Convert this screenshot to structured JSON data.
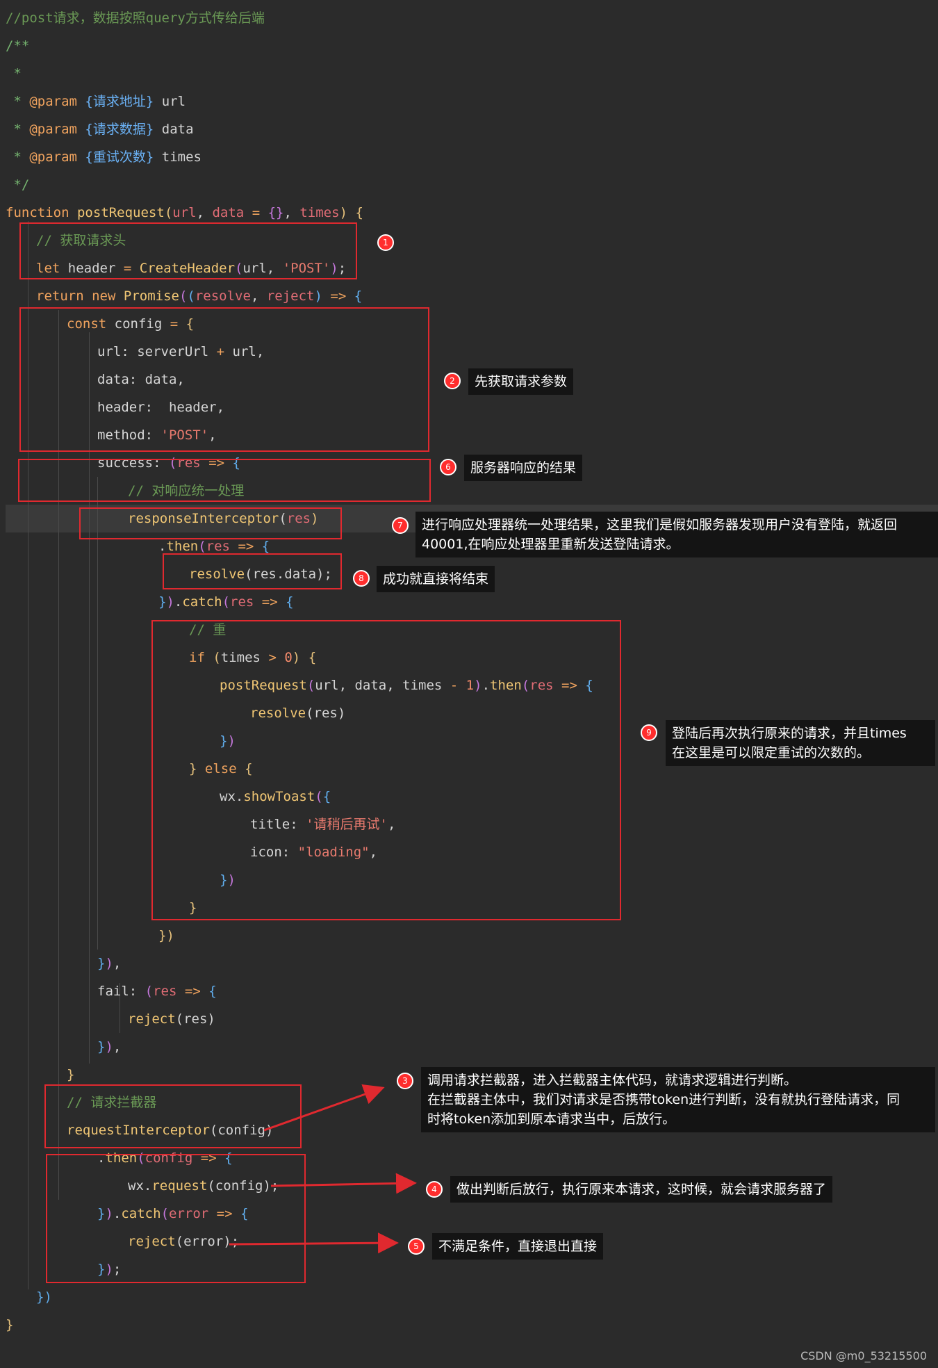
{
  "code_lines": [
    {
      "indent": 0,
      "tokens": [
        [
          "//post请求，数据按照query方式传给后端",
          "comment"
        ]
      ]
    },
    {
      "indent": 0,
      "tokens": [
        [
          "/**",
          "doc"
        ]
      ]
    },
    {
      "indent": 0,
      "tokens": [
        [
          " *",
          "doc"
        ]
      ]
    },
    {
      "indent": 0,
      "tokens": [
        [
          " * ",
          "doc"
        ],
        [
          "@param",
          "keyword"
        ],
        [
          " ",
          "doc"
        ],
        [
          "{请求地址}",
          "type"
        ],
        [
          " url",
          "plain"
        ]
      ]
    },
    {
      "indent": 0,
      "tokens": [
        [
          " * ",
          "doc"
        ],
        [
          "@param",
          "keyword"
        ],
        [
          " ",
          "doc"
        ],
        [
          "{请求数据}",
          "type"
        ],
        [
          " data",
          "plain"
        ]
      ]
    },
    {
      "indent": 0,
      "tokens": [
        [
          " * ",
          "doc"
        ],
        [
          "@param",
          "keyword"
        ],
        [
          " ",
          "doc"
        ],
        [
          "{重试次数}",
          "type"
        ],
        [
          " times",
          "plain"
        ]
      ]
    },
    {
      "indent": 0,
      "tokens": [
        [
          " */",
          "doc"
        ]
      ]
    },
    {
      "indent": 0,
      "tokens": [
        [
          "function",
          "keyword"
        ],
        [
          " ",
          "plain"
        ],
        [
          "postRequest",
          "func"
        ],
        [
          "(",
          "bracket1"
        ],
        [
          "url",
          "param"
        ],
        [
          ", ",
          "plain"
        ],
        [
          "data",
          "param"
        ],
        [
          " = ",
          "op"
        ],
        [
          "{}",
          "bracket2"
        ],
        [
          ", ",
          "plain"
        ],
        [
          "times",
          "param"
        ],
        [
          ")",
          "bracket1"
        ],
        [
          " ",
          "plain"
        ],
        [
          "{",
          "bracket1"
        ]
      ]
    },
    {
      "indent": 1,
      "tokens": [
        [
          "// 获取请求头",
          "comment"
        ]
      ]
    },
    {
      "indent": 1,
      "tokens": [
        [
          "let",
          "keyword"
        ],
        [
          " header ",
          "plain"
        ],
        [
          "=",
          "op"
        ],
        [
          " ",
          "plain"
        ],
        [
          "CreateHeader",
          "func"
        ],
        [
          "(",
          "bracket2"
        ],
        [
          "url, ",
          "plain"
        ],
        [
          "'POST'",
          "string"
        ],
        [
          ")",
          "bracket2"
        ],
        [
          ";",
          "plain"
        ]
      ]
    },
    {
      "indent": 1,
      "tokens": [
        [
          "return",
          "keyword"
        ],
        [
          " ",
          "plain"
        ],
        [
          "new",
          "keyword"
        ],
        [
          " ",
          "plain"
        ],
        [
          "Promise",
          "func"
        ],
        [
          "(",
          "bracket2"
        ],
        [
          "(",
          "bracket3"
        ],
        [
          "resolve",
          "param"
        ],
        [
          ", ",
          "plain"
        ],
        [
          "reject",
          "param"
        ],
        [
          ")",
          "bracket3"
        ],
        [
          " ",
          "plain"
        ],
        [
          "=>",
          "keyword"
        ],
        [
          " ",
          "plain"
        ],
        [
          "{",
          "bracket3"
        ]
      ]
    },
    {
      "indent": 2,
      "tokens": [
        [
          "const",
          "keyword"
        ],
        [
          " config ",
          "plain"
        ],
        [
          "=",
          "op"
        ],
        [
          " ",
          "plain"
        ],
        [
          "{",
          "bracket1"
        ]
      ]
    },
    {
      "indent": 3,
      "tokens": [
        [
          "url",
          "prop"
        ],
        [
          ": serverUrl ",
          "plain"
        ],
        [
          "+",
          "op"
        ],
        [
          " url,",
          "plain"
        ]
      ]
    },
    {
      "indent": 3,
      "tokens": [
        [
          "data",
          "prop"
        ],
        [
          ": data,",
          "plain"
        ]
      ]
    },
    {
      "indent": 3,
      "tokens": [
        [
          "header",
          "prop"
        ],
        [
          ":  header,",
          "plain"
        ]
      ]
    },
    {
      "indent": 3,
      "tokens": [
        [
          "method",
          "prop"
        ],
        [
          ": ",
          "plain"
        ],
        [
          "'POST'",
          "string"
        ],
        [
          ",",
          "plain"
        ]
      ]
    },
    {
      "indent": 3,
      "tokens": [
        [
          "success",
          "prop"
        ],
        [
          ": ",
          "plain"
        ],
        [
          "(",
          "bracket2"
        ],
        [
          "res",
          "param"
        ],
        [
          " ",
          "plain"
        ],
        [
          "=>",
          "keyword"
        ],
        [
          " ",
          "plain"
        ],
        [
          "{",
          "bracket3"
        ]
      ]
    },
    {
      "indent": 4,
      "tokens": [
        [
          "// 对响应统一处理",
          "comment"
        ]
      ]
    },
    {
      "indent": 4,
      "tokens": [
        [
          "responseInterceptor",
          "func"
        ],
        [
          "(",
          "plain"
        ],
        [
          "res",
          "param"
        ],
        [
          ")",
          "bracket1"
        ]
      ]
    },
    {
      "indent": 5,
      "tokens": [
        [
          ".",
          "plain"
        ],
        [
          "then",
          "func"
        ],
        [
          "(",
          "bracket2"
        ],
        [
          "res",
          "param"
        ],
        [
          " ",
          "plain"
        ],
        [
          "=>",
          "keyword"
        ],
        [
          " ",
          "plain"
        ],
        [
          "{",
          "bracket3"
        ]
      ]
    },
    {
      "indent": 6,
      "tokens": [
        [
          "resolve",
          "func"
        ],
        [
          "(res.data);",
          "plain"
        ]
      ]
    },
    {
      "indent": 5,
      "tokens": [
        [
          "}",
          "bracket3"
        ],
        [
          ")",
          "bracket2"
        ],
        [
          ".",
          "plain"
        ],
        [
          "catch",
          "func"
        ],
        [
          "(",
          "bracket2"
        ],
        [
          "res",
          "param"
        ],
        [
          " ",
          "plain"
        ],
        [
          "=>",
          "keyword"
        ],
        [
          " ",
          "plain"
        ],
        [
          "{",
          "bracket3"
        ]
      ]
    },
    {
      "indent": 6,
      "tokens": [
        [
          "// 重",
          "comment"
        ]
      ]
    },
    {
      "indent": 6,
      "tokens": [
        [
          "if",
          "keyword"
        ],
        [
          " ",
          "plain"
        ],
        [
          "(",
          "bracket1"
        ],
        [
          "times ",
          "plain"
        ],
        [
          ">",
          "op"
        ],
        [
          " ",
          "plain"
        ],
        [
          "0",
          "number"
        ],
        [
          ")",
          "bracket1"
        ],
        [
          " ",
          "plain"
        ],
        [
          "{",
          "bracket1"
        ]
      ]
    },
    {
      "indent": 7,
      "tokens": [
        [
          "postRequest",
          "func"
        ],
        [
          "(",
          "bracket2"
        ],
        [
          "url, data, times ",
          "plain"
        ],
        [
          "-",
          "op"
        ],
        [
          " ",
          "plain"
        ],
        [
          "1",
          "number"
        ],
        [
          ")",
          "bracket2"
        ],
        [
          ".",
          "plain"
        ],
        [
          "then",
          "func"
        ],
        [
          "(",
          "bracket2"
        ],
        [
          "res",
          "param"
        ],
        [
          " ",
          "plain"
        ],
        [
          "=>",
          "keyword"
        ],
        [
          " ",
          "plain"
        ],
        [
          "{",
          "bracket3"
        ]
      ]
    },
    {
      "indent": 8,
      "tokens": [
        [
          "resolve",
          "func"
        ],
        [
          "(res)",
          "plain"
        ]
      ]
    },
    {
      "indent": 7,
      "tokens": [
        [
          "}",
          "bracket3"
        ],
        [
          ")",
          "bracket2"
        ]
      ]
    },
    {
      "indent": 6,
      "tokens": [
        [
          "}",
          "bracket1"
        ],
        [
          " ",
          "plain"
        ],
        [
          "else",
          "keyword"
        ],
        [
          " ",
          "plain"
        ],
        [
          "{",
          "bracket1"
        ]
      ]
    },
    {
      "indent": 7,
      "tokens": [
        [
          "wx.",
          "plain"
        ],
        [
          "showToast",
          "func"
        ],
        [
          "(",
          "bracket2"
        ],
        [
          "{",
          "bracket3"
        ]
      ]
    },
    {
      "indent": 8,
      "tokens": [
        [
          "title",
          "prop"
        ],
        [
          ": ",
          "plain"
        ],
        [
          "'请稍后再试'",
          "string"
        ],
        [
          ",",
          "plain"
        ]
      ]
    },
    {
      "indent": 8,
      "tokens": [
        [
          "icon",
          "prop"
        ],
        [
          ": ",
          "plain"
        ],
        [
          "\"loading\"",
          "string"
        ],
        [
          ",",
          "plain"
        ]
      ]
    },
    {
      "indent": 7,
      "tokens": [
        [
          "}",
          "bracket3"
        ],
        [
          ")",
          "bracket2"
        ]
      ]
    },
    {
      "indent": 6,
      "tokens": [
        [
          "}",
          "bracket1"
        ]
      ]
    },
    {
      "indent": 5,
      "tokens": [
        [
          "})",
          "bracket1"
        ]
      ]
    },
    {
      "indent": 3,
      "tokens": [
        [
          "}",
          "bracket3"
        ],
        [
          ")",
          "bracket2"
        ],
        [
          ",",
          "plain"
        ]
      ]
    },
    {
      "indent": 3,
      "tokens": [
        [
          "fail",
          "prop"
        ],
        [
          ": ",
          "plain"
        ],
        [
          "(",
          "bracket2"
        ],
        [
          "res",
          "param"
        ],
        [
          " ",
          "plain"
        ],
        [
          "=>",
          "keyword"
        ],
        [
          " ",
          "plain"
        ],
        [
          "{",
          "bracket3"
        ]
      ]
    },
    {
      "indent": 4,
      "tokens": [
        [
          "reject",
          "func"
        ],
        [
          "(res)",
          "plain"
        ]
      ]
    },
    {
      "indent": 3,
      "tokens": [
        [
          "}",
          "bracket3"
        ],
        [
          ")",
          "bracket2"
        ],
        [
          ",",
          "plain"
        ]
      ]
    },
    {
      "indent": 2,
      "tokens": [
        [
          "}",
          "bracket1"
        ]
      ]
    },
    {
      "indent": 2,
      "tokens": [
        [
          "// 请求拦截器",
          "comment"
        ]
      ]
    },
    {
      "indent": 2,
      "tokens": [
        [
          "requestInterceptor",
          "func"
        ],
        [
          "(config)",
          "plain"
        ]
      ]
    },
    {
      "indent": 3,
      "tokens": [
        [
          ".",
          "plain"
        ],
        [
          "then",
          "func"
        ],
        [
          "(",
          "bracket2"
        ],
        [
          "config",
          "param"
        ],
        [
          " ",
          "plain"
        ],
        [
          "=>",
          "keyword"
        ],
        [
          " ",
          "plain"
        ],
        [
          "{",
          "bracket3"
        ]
      ]
    },
    {
      "indent": 4,
      "tokens": [
        [
          "wx.",
          "plain"
        ],
        [
          "request",
          "func"
        ],
        [
          "(config);",
          "plain"
        ]
      ]
    },
    {
      "indent": 3,
      "tokens": [
        [
          "}",
          "bracket3"
        ],
        [
          ")",
          "bracket2"
        ],
        [
          ".",
          "plain"
        ],
        [
          "catch",
          "func"
        ],
        [
          "(",
          "bracket2"
        ],
        [
          "error",
          "param"
        ],
        [
          " ",
          "plain"
        ],
        [
          "=>",
          "keyword"
        ],
        [
          " ",
          "plain"
        ],
        [
          "{",
          "bracket3"
        ]
      ]
    },
    {
      "indent": 4,
      "tokens": [
        [
          "reject",
          "func"
        ],
        [
          "(error);",
          "plain"
        ]
      ]
    },
    {
      "indent": 3,
      "tokens": [
        [
          "}",
          "bracket3"
        ],
        [
          ")",
          "bracket2"
        ],
        [
          ";",
          "plain"
        ]
      ]
    },
    {
      "indent": 1,
      "tokens": [
        [
          "})",
          "bracket3"
        ]
      ]
    },
    {
      "indent": 0,
      "tokens": [
        [
          "}",
          "bracket1"
        ]
      ]
    }
  ],
  "annotations": [
    {
      "number": "1",
      "text": ""
    },
    {
      "number": "2",
      "text": "先获取请求参数"
    },
    {
      "number": "6",
      "text": "服务器响应的结果"
    },
    {
      "number": "7",
      "text": "进行响应处理器统一处理结果，这里我们是假如服务器发现用户没有登陆，就返回\n40001,在响应处理器里重新发送登陆请求。"
    },
    {
      "number": "8",
      "text": "成功就直接将结束"
    },
    {
      "number": "9",
      "text": "登陆后再次执行原来的请求，并且times\n在这里是可以限定重试的次数的。"
    },
    {
      "number": "3",
      "text": "调用请求拦截器，进入拦截器主体代码，就请求逻辑进行判断。\n在拦截器主体中，我们对请求是否携带token进行判断，没有就执行登陆请求，同\n时将token添加到原本请求当中，后放行。"
    },
    {
      "number": "4",
      "text": "做出判断后放行，执行原来本请求，这时候，就会请求服务器了"
    },
    {
      "number": "5",
      "text": "不满足条件，直接退出直接"
    }
  ],
  "watermark": "CSDN @m0_53215500",
  "colors": {
    "background": "#2b2b2b",
    "annotation_box": "#e0292f",
    "badge": "#ff2d2d"
  }
}
